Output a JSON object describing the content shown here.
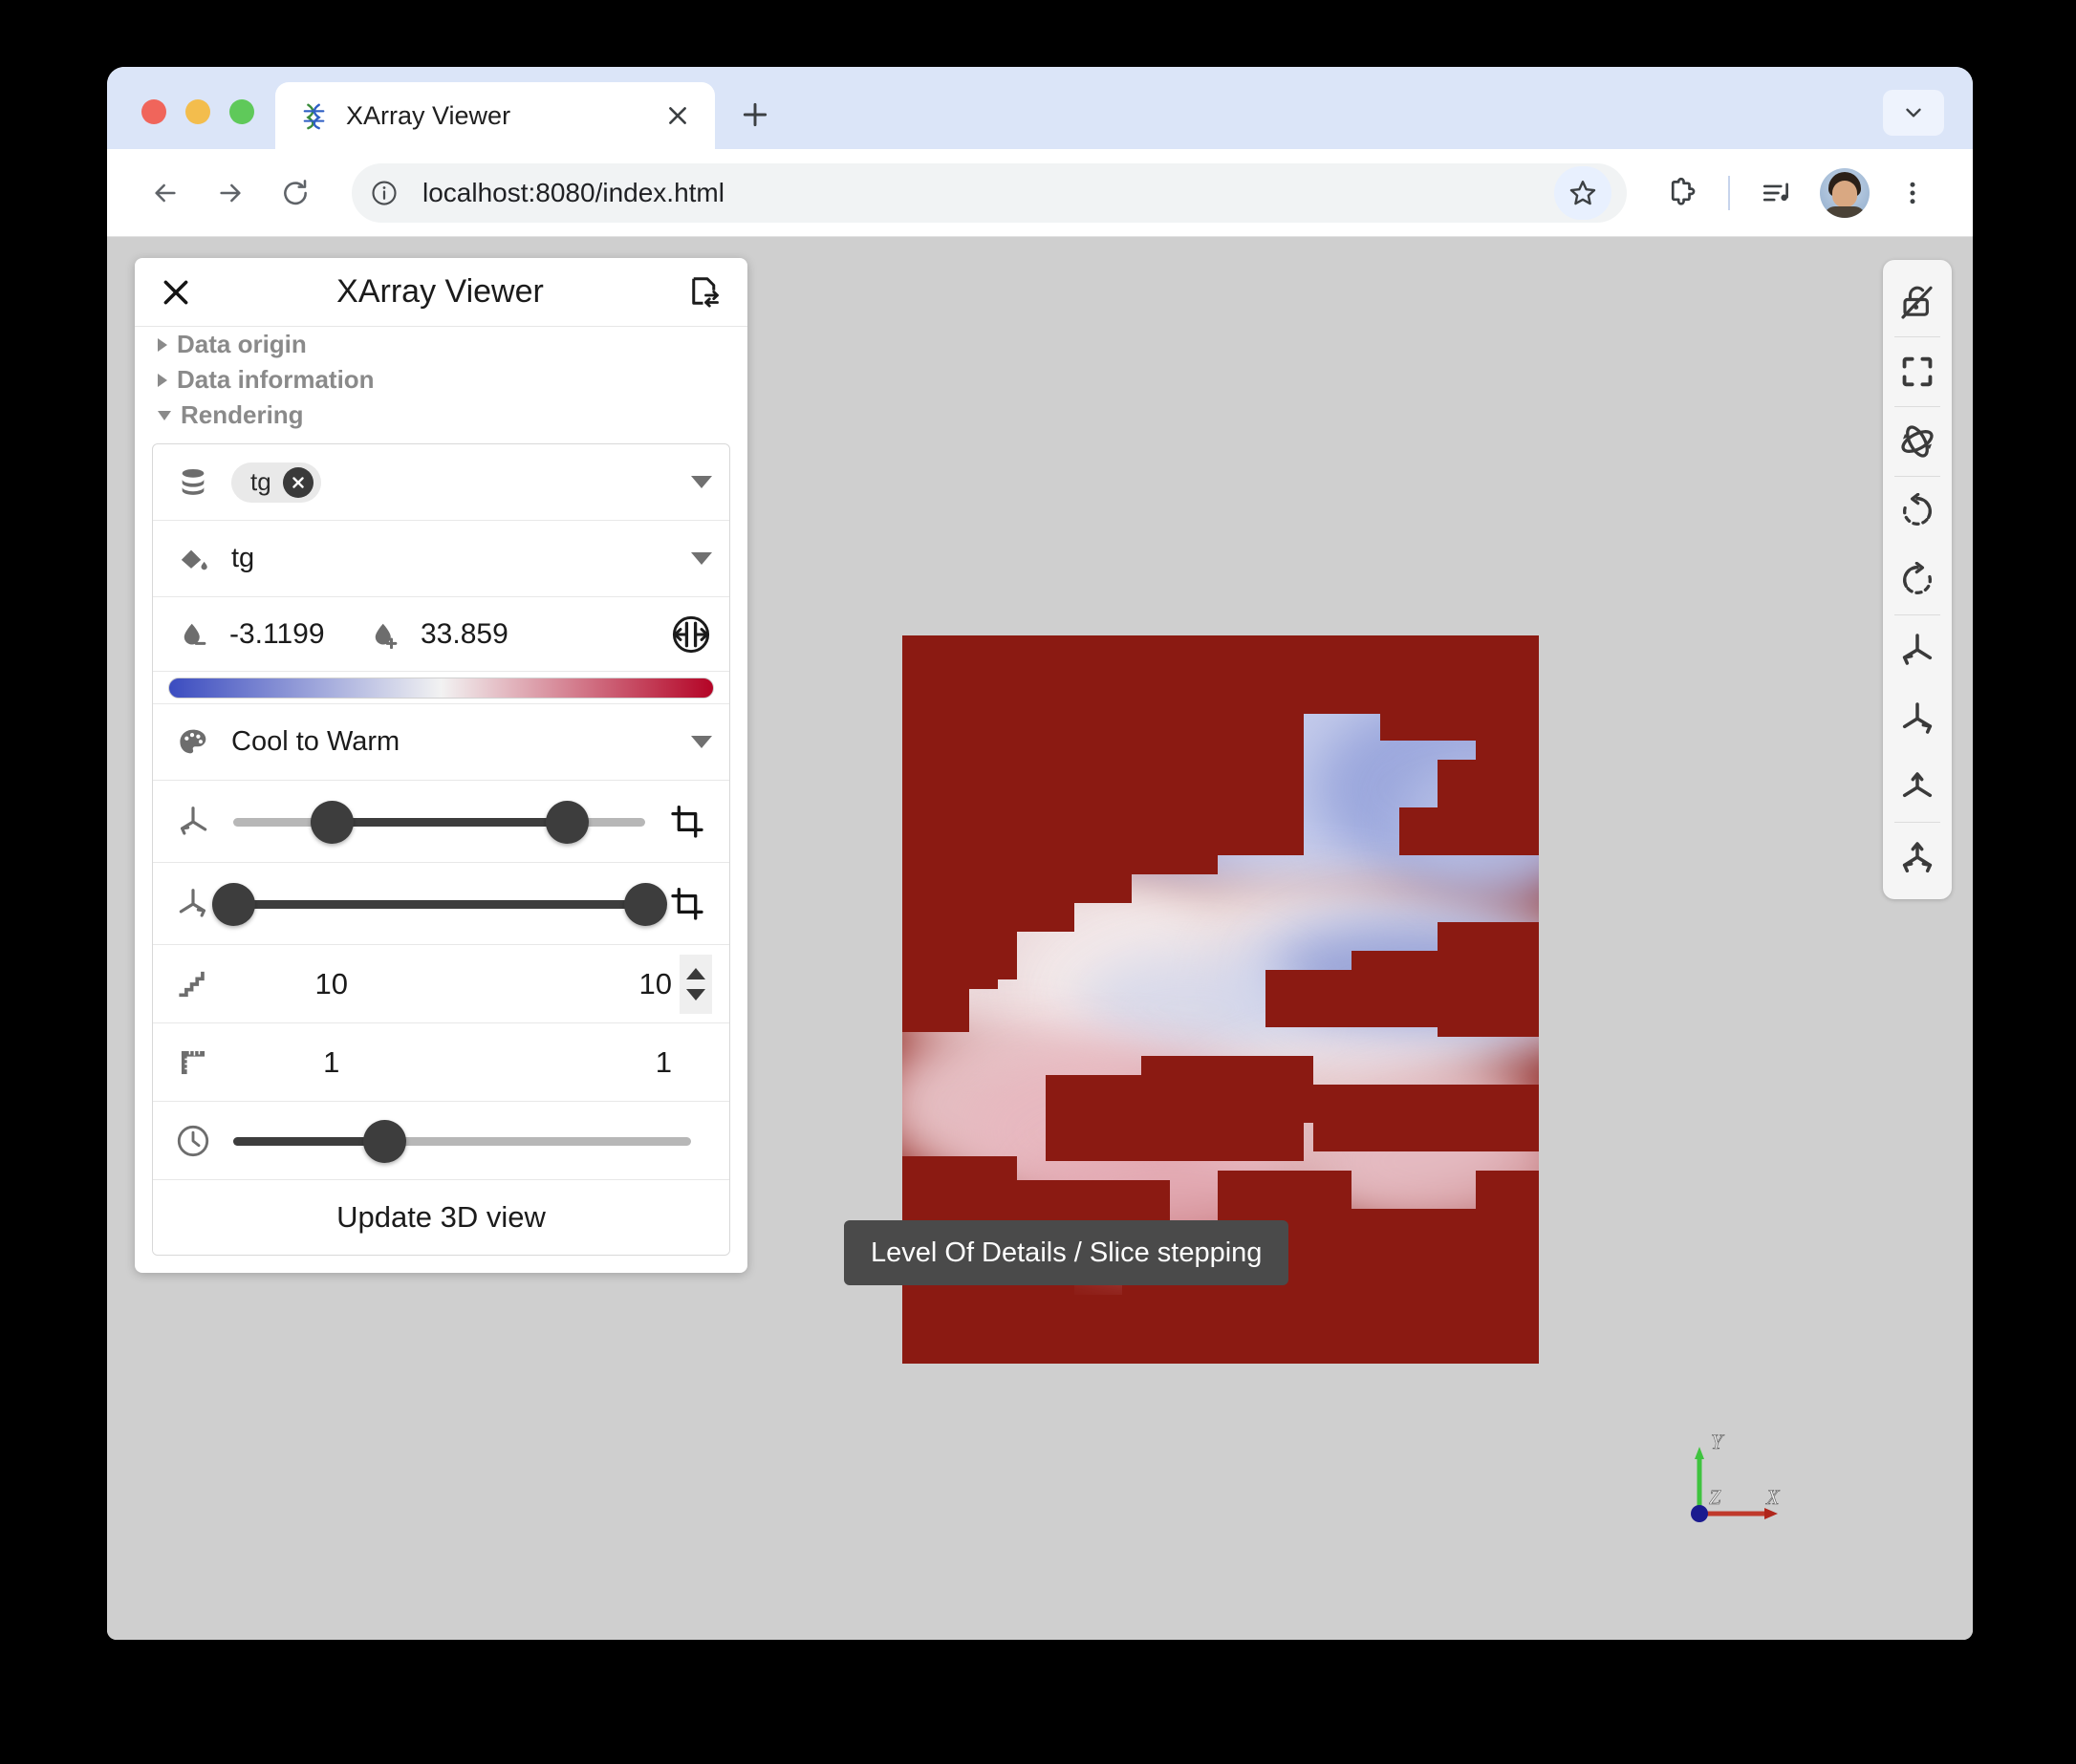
{
  "browser": {
    "tab": {
      "title": "XArray Viewer",
      "favicon_icon": "xarray-logo-icon",
      "close_icon": "close-icon"
    },
    "new_tab_icon": "plus-icon",
    "tabstrip_chevron_icon": "chevron-down-icon",
    "back_icon": "arrow-left-icon",
    "forward_icon": "arrow-right-icon",
    "reload_icon": "reload-icon",
    "site_info_icon": "info-circle-icon",
    "url": "localhost:8080/index.html",
    "bookmark_icon": "star-icon",
    "extensions_icon": "puzzle-icon",
    "media_icon": "media-playlist-icon",
    "avatar_icon": "user-avatar",
    "menu_icon": "three-dot-menu-icon",
    "traffic_lights": [
      "close",
      "minimize",
      "maximize"
    ]
  },
  "panel": {
    "title": "XArray Viewer",
    "close_icon": "close-icon",
    "swap_icon": "file-exchange-icon",
    "sections": [
      {
        "label": "Data origin",
        "expanded": false
      },
      {
        "label": "Data information",
        "expanded": false
      },
      {
        "label": "Rendering",
        "expanded": true
      }
    ],
    "rendering": {
      "dataset": {
        "icon": "database-icon",
        "chip_label": "tg",
        "chip_remove_icon": "remove-circle-icon",
        "dropdown_icon": "chevron-down-icon"
      },
      "color_by": {
        "icon": "fill-color-icon",
        "value": "tg",
        "dropdown_icon": "chevron-down-icon"
      },
      "range": {
        "min_icon": "droplet-minus-icon",
        "min_value": "-3.1199",
        "max_icon": "droplet-plus-icon",
        "max_value": "33.859",
        "rescale_icon": "rescale-range-icon"
      },
      "colormap": {
        "icon": "palette-icon",
        "value": "Cool to Warm",
        "dropdown_icon": "chevron-down-icon",
        "color_low": "#3b4cc0",
        "color_mid": "#f2f2f2",
        "color_high": "#b40426"
      },
      "slice_x": {
        "icon": "axis-x-icon",
        "crop_icon": "crop-icon",
        "low_pct": 24,
        "high_pct": 81
      },
      "slice_y": {
        "icon": "axis-y-icon",
        "crop_icon": "crop-icon",
        "low_pct": 0,
        "high_pct": 100
      },
      "level_of_details": {
        "icon": "stair-step-icon",
        "value_x": "10",
        "value_y": "10",
        "spinner_up_icon": "caret-up-icon",
        "spinner_down_icon": "caret-down-icon"
      },
      "scale": {
        "icon": "ruler-icon",
        "value_x": "1",
        "value_y": "1"
      },
      "time": {
        "icon": "clock-icon",
        "position_pct": 33
      },
      "update_button": "Update 3D view"
    }
  },
  "tooltip": {
    "text": "Level Of Details / Slice stepping"
  },
  "view_toolbar": {
    "buttons": [
      {
        "name": "toggle-interaction-lock",
        "icon": "lock-off-icon"
      },
      {
        "name": "reset-camera",
        "icon": "fullscreen-reset-icon"
      },
      {
        "name": "rotate-3d",
        "icon": "orbit-icon"
      },
      {
        "name": "rotate-left",
        "icon": "rotate-ccw-icon"
      },
      {
        "name": "rotate-right",
        "icon": "rotate-cw-icon"
      },
      {
        "name": "view-minus-x",
        "icon": "axis-minus-x-icon"
      },
      {
        "name": "view-plus-x",
        "icon": "axis-plus-x-icon"
      },
      {
        "name": "view-plus-y",
        "icon": "axis-plus-y-icon"
      },
      {
        "name": "view-isometric",
        "icon": "axis-isometric-icon"
      }
    ]
  },
  "orientation_axes": {
    "x_label": "X",
    "y_label": "Y",
    "z_label": "Z",
    "x_color": "#c0392b",
    "y_color": "#3fc33f",
    "z_color": "#1b1b8f"
  },
  "viewport": {
    "background_color": "#cfcfcf",
    "data_background_color": "#8b1a12"
  }
}
